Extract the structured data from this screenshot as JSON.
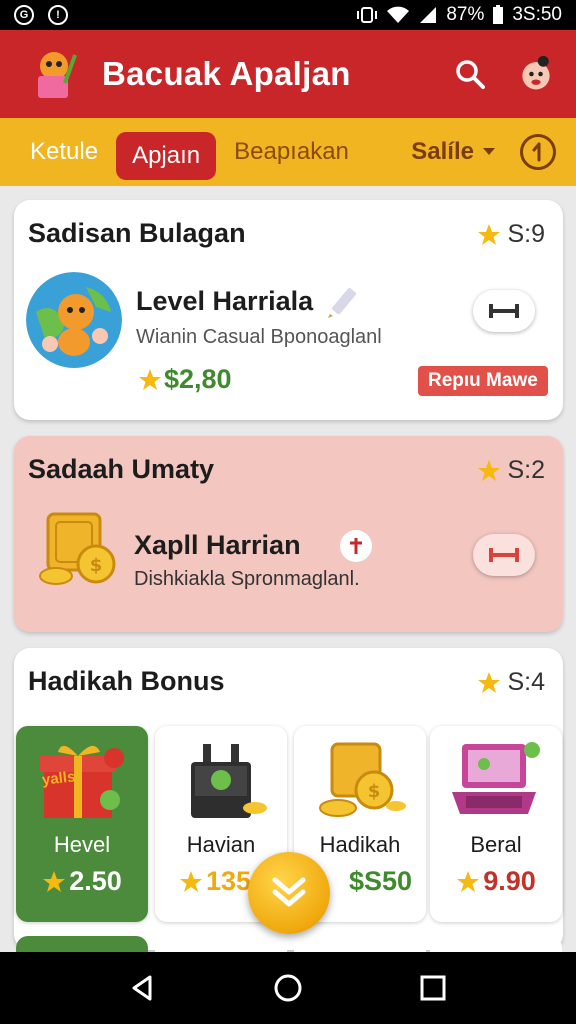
{
  "status_bar": {
    "time": "3S:50",
    "battery": "87%"
  },
  "app_bar": {
    "title": "Bacuak Apaljan"
  },
  "tabs": [
    {
      "label": "Ketule"
    },
    {
      "label": "Apjaın"
    },
    {
      "label": "Beapıakan"
    }
  ],
  "sort": {
    "label": "Salíle"
  },
  "sections": [
    {
      "title": "Sadisan Bulagan",
      "score": "S:9",
      "item_title": "Level Harriala",
      "item_sub": "Wianin Casual Bponoaglanl",
      "price": "$2,80",
      "tag": "Repıu Mawe"
    },
    {
      "title": "Sadaah Umaty",
      "score": "S:2",
      "item_title": "Xapll Harrian",
      "item_sub": "Dishkiakla Spronmaglanl."
    },
    {
      "title": "Hadikah Bonus",
      "score": "S:4",
      "tiles": [
        {
          "label": "Hevel",
          "price": "2.50",
          "image_text": "yalls"
        },
        {
          "label": "Havian",
          "price": "135"
        },
        {
          "label": "Hadikah",
          "price": "$S50"
        },
        {
          "label": "Beral",
          "price": "9.90"
        }
      ]
    }
  ],
  "colors": {
    "primary_red": "#c9262a",
    "accent_yellow": "#f2b522",
    "price_green": "#3f8a2c",
    "tile_green": "#4c8a3c"
  }
}
